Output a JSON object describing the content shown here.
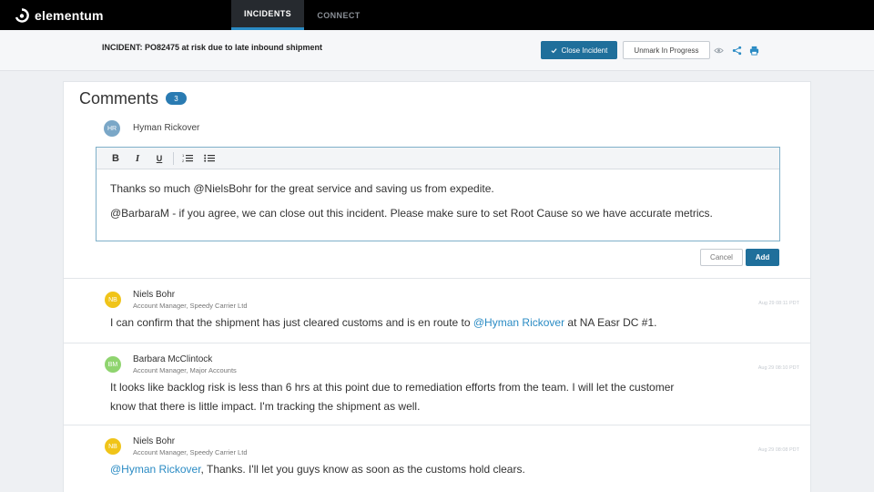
{
  "app": {
    "brand": "elementum"
  },
  "nav": {
    "tabs": [
      "INCIDENTS",
      "CONNECT"
    ]
  },
  "incident": {
    "title": "INCIDENT: PO82475 at risk due to late inbound shipment",
    "close_label": "Close Incident",
    "unmark_label": "Unmark In Progress"
  },
  "comments": {
    "heading": "Comments",
    "count": "3",
    "composer": {
      "initials": "HR",
      "name": "Hyman Rickover",
      "line1": "Thanks so much @NielsBohr for the great service and saving us from expedite.",
      "line2": "@BarbaraM - if you agree, we can close out this incident. Please make sure to set Root Cause so we have accurate metrics.",
      "cancel_label": "Cancel",
      "add_label": "Add"
    },
    "items": [
      {
        "initials": "NB",
        "name": "Niels Bohr",
        "role": "Account Manager, Speedy Carrier Ltd",
        "time": "Aug 29 08:11 PDT",
        "text_before": "I can confirm that the shipment has just cleared customs and is en route to ",
        "mention": "@Hyman Rickover",
        "text_after": " at NA Easr DC #1.",
        "avatar_color": "#f0c419"
      },
      {
        "initials": "BM",
        "name": "Barbara McClintock",
        "role": "Account Manager, Major Accounts",
        "time": "Aug 29 08:10 PDT",
        "text": "It looks like backlog risk is less than 6 hrs at this point due to remediation efforts from the team. I will let the customer know that there is little impact. I'm tracking the shipment as well.",
        "avatar_color": "#8fd46f"
      },
      {
        "initials": "NB",
        "name": "Niels Bohr",
        "role": "Account Manager, Speedy Carrier Ltd",
        "time": "Aug 29 08:08 PDT",
        "mention": "@Hyman Rickover",
        "text_after": ", Thanks. I'll let you guys know as soon as the customs hold clears.",
        "avatar_color": "#f0c419"
      }
    ]
  },
  "icons": [
    "logo-icon",
    "check-icon",
    "eye-icon",
    "share-icon",
    "print-icon",
    "bold-icon",
    "italic-icon",
    "underline-icon",
    "ordered-list-icon",
    "bullet-list-icon"
  ]
}
